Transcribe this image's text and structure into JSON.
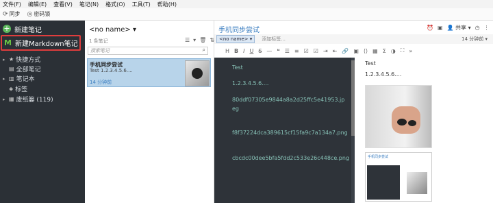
{
  "menu": [
    "文件(F)",
    "编辑(E)",
    "查看(V)",
    "笔记(N)",
    "格式(O)",
    "工具(T)",
    "帮助(H)"
  ],
  "toolbar": {
    "sync": "同步",
    "pwd": "密码锁"
  },
  "sidebar": {
    "new_note": "新建笔记",
    "new_markdown": "新建Markdown笔记",
    "items": [
      {
        "label": "快捷方式",
        "icon": "star-icon"
      },
      {
        "label": "全部笔记",
        "icon": "notes-icon"
      },
      {
        "label": "笔记本",
        "icon": "notebook-icon"
      },
      {
        "label": "标签",
        "icon": "tag-icon"
      },
      {
        "label": "废纸篓 (119)",
        "icon": "trash-icon"
      }
    ]
  },
  "list": {
    "notebook": "<no name>",
    "count": "1 条笔记",
    "search_placeholder": "搜索笔记",
    "note": {
      "title": "手机同步尝试",
      "snippet": "Test 1.2.3.4.5.6....",
      "date": "14 分钟前"
    }
  },
  "editor": {
    "title": "手机同步尝试",
    "share": "共享",
    "notebook_select": "<no name>",
    "add_tag": "添加标签...",
    "font_size": "14 分钟前",
    "md_lines": [
      "Test",
      "1.2.3.4.5.6....",
      "80ddf07305e9844a8a2d25ffc5e41953.jp",
      "eg",
      "f8f37224dca389615cf15fa9c7a134a7.png",
      "cbcdc00dee5bfa5fdd2c533e26c448ce.png"
    ],
    "preview_lines": [
      "Test",
      "1.2.3.4.5.6...."
    ],
    "preview_subtitle": "手机同步尝试"
  },
  "colors": {
    "sidebar": "#2b3036",
    "accent": "#3a7dc0",
    "highlight": "#e03d3d",
    "md_bg": "#2e3339",
    "md_text": "#88c3b8"
  }
}
